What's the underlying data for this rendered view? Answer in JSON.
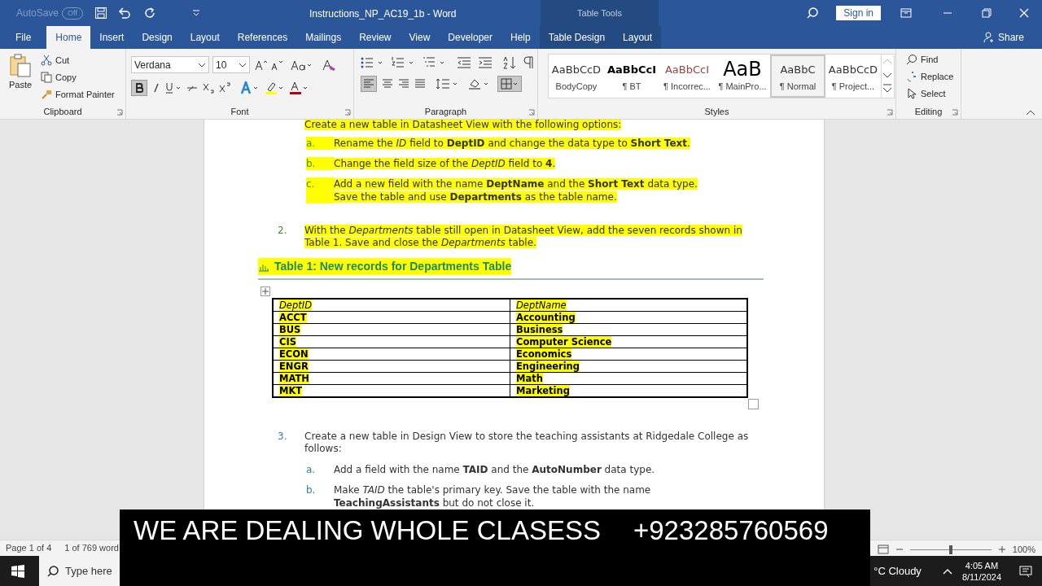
{
  "title_bar": {
    "autosave_label": "AutoSave",
    "autosave_state": "Off",
    "document_title": "Instructions_NP_AC19_1b  -  Word",
    "contextual_group": "Table Tools",
    "sign_in": "Sign in"
  },
  "ribbon_tabs": [
    {
      "label": "File",
      "selected": false,
      "contextual": false
    },
    {
      "label": "Home",
      "selected": true,
      "contextual": false
    },
    {
      "label": "Insert",
      "selected": false,
      "contextual": false
    },
    {
      "label": "Design",
      "selected": false,
      "contextual": false
    },
    {
      "label": "Layout",
      "selected": false,
      "contextual": false
    },
    {
      "label": "References",
      "selected": false,
      "contextual": false
    },
    {
      "label": "Mailings",
      "selected": false,
      "contextual": false
    },
    {
      "label": "Review",
      "selected": false,
      "contextual": false
    },
    {
      "label": "View",
      "selected": false,
      "contextual": false
    },
    {
      "label": "Developer",
      "selected": false,
      "contextual": false
    },
    {
      "label": "Help",
      "selected": false,
      "contextual": false
    },
    {
      "label": "Table Design",
      "selected": false,
      "contextual": true
    },
    {
      "label": "Layout",
      "selected": false,
      "contextual": true
    }
  ],
  "share": "Share",
  "ribbon": {
    "clipboard": {
      "paste": "Paste",
      "cut": "Cut",
      "copy": "Copy",
      "format_painter": "Format Painter",
      "group": "Clipboard"
    },
    "font": {
      "font_name": "Verdana",
      "font_size": "10",
      "bold_on": true,
      "group": "Font"
    },
    "paragraph": {
      "align_left_on": true,
      "group": "Paragraph"
    },
    "styles": {
      "group": "Styles",
      "items": [
        {
          "preview": "AaBbCcD",
          "name": "BodyCopy",
          "kind": "plain",
          "selected": false
        },
        {
          "preview": "AaBbCcI",
          "name": "¶ BT",
          "kind": "bold",
          "selected": false
        },
        {
          "preview": "AaBbCcI",
          "name": "¶ Incorrec...",
          "kind": "red",
          "selected": false
        },
        {
          "preview": "AaB",
          "name": "¶ MainPro...",
          "kind": "large",
          "selected": false
        },
        {
          "preview": "AaBbC",
          "name": "¶ Normal",
          "kind": "plain",
          "selected": true
        },
        {
          "preview": "AaBbCcD",
          "name": "¶ Project...",
          "kind": "plain",
          "selected": false
        }
      ]
    },
    "editing": {
      "find": "Find",
      "replace": "Replace",
      "select": "Select",
      "group": "Editing"
    }
  },
  "document": {
    "cut_line": "Create a new table in Datasheet View with the following options:",
    "blocks": [
      {
        "kind": "substeps",
        "highlighted": true,
        "items": [
          {
            "marker": "a.",
            "text": "Rename the *ID* field to **DeptID** and change the data type to **Short Text**."
          },
          {
            "marker": "b.",
            "text": "Change the field size of the *DeptID* field to **4**."
          },
          {
            "marker": "c.",
            "text": "Add a new field with the name **DeptName** and the **Short Text** data type. Save the table and use **Departments** as the table name."
          }
        ]
      },
      {
        "kind": "step",
        "highlighted": true,
        "marker": "2.",
        "text": "With the *Departments* table still open in Datasheet View, add the seven records shown in Table 1. Save and close the *Departments* table."
      },
      {
        "kind": "caption",
        "highlighted": true,
        "text": "Table 1: New records for Departments Table"
      },
      {
        "kind": "table",
        "highlighted": true,
        "columns": [
          "DeptID",
          "DeptName"
        ],
        "rows": [
          [
            "ACCT",
            "Accounting"
          ],
          [
            "BUS",
            "Business"
          ],
          [
            "CIS",
            "Computer Science"
          ],
          [
            "ECON",
            "Economics"
          ],
          [
            "ENGR",
            "Engineering"
          ],
          [
            "MATH",
            "Math"
          ],
          [
            "MKT",
            "Marketing"
          ]
        ]
      },
      {
        "kind": "step",
        "highlighted": false,
        "marker": "3.",
        "text": "Create a new table in Design View to store the teaching assistants at Ridgedale College as follows:"
      },
      {
        "kind": "substeps",
        "highlighted": false,
        "items": [
          {
            "marker": "a.",
            "text": "Add a field with the name **TAID** and the **AutoNumber** data type."
          },
          {
            "marker": "b.",
            "text": "Make *TAID* the table's primary key. Save the table with the name **TeachingAssistants** but do not close it."
          }
        ]
      }
    ]
  },
  "status_bar": {
    "page": "Page 1 of 4",
    "words": "1 of 769 word",
    "zoom": "100%",
    "zoom_slider": {
      "level": 0.5
    }
  },
  "taskbar": {
    "search_placeholder": "Type here",
    "weather": "°C  Cloudy",
    "time": "4:05 AM",
    "date": "8/11/2024"
  },
  "banner": {
    "text": "WE ARE DEALING WHOLE CLASESS",
    "phone": "+923285760569"
  }
}
